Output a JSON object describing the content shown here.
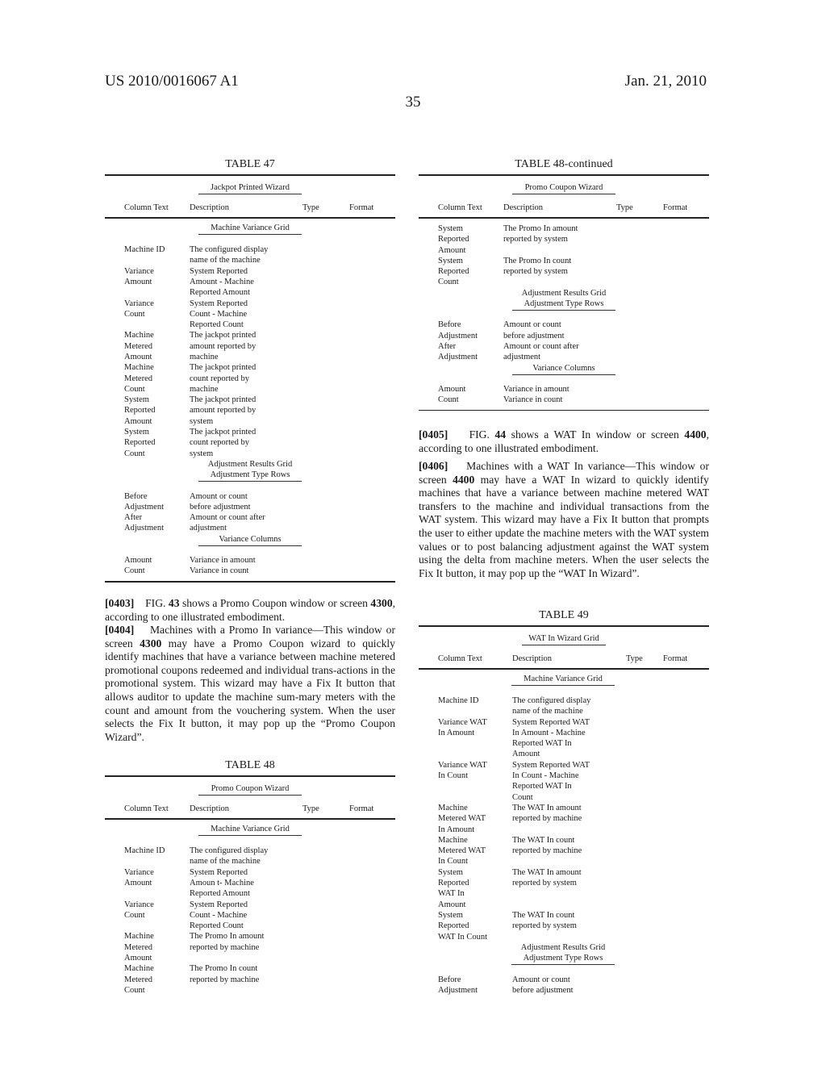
{
  "header": {
    "patent_number": "US 2010/0016067 A1",
    "date": "Jan. 21, 2010",
    "page_number": "35"
  },
  "column_headers": [
    "Column Text",
    "Description",
    "Type",
    "Format"
  ],
  "table47": {
    "title": "TABLE 47",
    "wizard": "Jackpot Printed Wizard",
    "sections": [
      {
        "heading": "Machine Variance Grid",
        "rows": [
          {
            "col": "Machine ID",
            "desc": "The configured display\nname of the machine"
          },
          {
            "col": "Variance\nAmount",
            "desc": "System Reported\nAmount - Machine\nReported Amount"
          },
          {
            "col": "Variance\nCount",
            "desc": "System Reported\nCount - Machine\nReported Count"
          },
          {
            "col": "Machine\nMetered\nAmount",
            "desc": "The jackpot printed\namount reported by\nmachine"
          },
          {
            "col": "Machine\nMetered\nCount",
            "desc": "The jackpot printed\ncount reported by\nmachine"
          },
          {
            "col": "System\nReported\nAmount",
            "desc": "The jackpot printed\namount reported by\nsystem"
          },
          {
            "col": "System\nReported\nCount",
            "desc": "The jackpot printed\ncount reported by\nsystem"
          }
        ]
      },
      {
        "heading_line1": "Adjustment Results Grid",
        "heading": "Adjustment Type Rows",
        "rows": [
          {
            "col": "Before\nAdjustment",
            "desc": "Amount or count\nbefore adjustment"
          },
          {
            "col": "After\nAdjustment",
            "desc": "Amount or count after\nadjustment"
          }
        ]
      },
      {
        "heading": "Variance Columns",
        "rows": [
          {
            "col": "Amount",
            "desc": "Variance in amount"
          },
          {
            "col": "Count",
            "desc": "Variance in count"
          }
        ]
      }
    ]
  },
  "paragraphs": {
    "p0403": {
      "num": "[0403]",
      "pre": "FIG. ",
      "fig": "43",
      "mid": " shows a Promo Coupon window or screen ",
      "ref": "4300",
      "post": ", according to one illustrated embodiment."
    },
    "p0404": {
      "num": "[0404]",
      "pre": "Machines with a Promo In variance—This window or screen ",
      "ref": "4300",
      "post": " may have a Promo Coupon wizard to quickly identify machines that have a variance between machine metered promotional coupons redeemed and individual trans-actions in the promotional system. This wizard may have a Fix It button that allows auditor to update the machine sum-mary meters with the count and amount from the vouchering system. When the user selects the Fix It button, it may pop up the “Promo Coupon Wizard”."
    },
    "p0405": {
      "num": "[0405]",
      "pre": "FIG. ",
      "fig": "44",
      "mid": " shows a WAT In window or screen ",
      "ref": "4400",
      "post": ", according to one illustrated embodiment."
    },
    "p0406": {
      "num": "[0406]",
      "pre": "Machines with a WAT In variance—This window or screen ",
      "ref": "4400",
      "post": " may have a WAT In wizard to quickly identify machines that have a variance between machine metered WAT transfers to the machine and individual transactions from the WAT system. This wizard may have a Fix It button that prompts the user to either update the machine meters with the WAT system values or to post balancing adjustment against the WAT system using the delta from machine meters. When the user selects the Fix It button, it may pop up the “WAT In Wizard”."
    }
  },
  "table48": {
    "title": "TABLE 48",
    "wizard": "Promo Coupon Wizard",
    "sections": [
      {
        "heading": "Machine Variance Grid",
        "rows": [
          {
            "col": "Machine ID",
            "desc": "The configured display\nname of the machine"
          },
          {
            "col": "Variance\nAmount",
            "desc": "System Reported\nAmoun t- Machine\nReported Amount"
          },
          {
            "col": "Variance\nCount",
            "desc": "System Reported\nCount - Machine\nReported Count"
          },
          {
            "col": "Machine\nMetered\nAmount",
            "desc": "The Promo In amount\nreported by machine"
          },
          {
            "col": "Machine\nMetered\nCount",
            "desc": "The Promo In count\nreported by machine"
          }
        ]
      }
    ]
  },
  "table48_cont": {
    "title": "TABLE 48-continued",
    "wizard": "Promo Coupon Wizard",
    "rows_top": [
      {
        "col": "System\nReported\nAmount",
        "desc": "The Promo In amount\nreported by system"
      },
      {
        "col": "System\nReported\nCount",
        "desc": "The Promo In count\nreported by system"
      }
    ],
    "sections": [
      {
        "heading_line1": "Adjustment Results Grid",
        "heading": "Adjustment Type Rows",
        "rows": [
          {
            "col": "Before\nAdjustment",
            "desc": "Amount or count\nbefore adjustment"
          },
          {
            "col": "After\nAdjustment",
            "desc": "Amount or count after\nadjustment"
          }
        ]
      },
      {
        "heading": "Variance Columns",
        "rows": [
          {
            "col": "Amount",
            "desc": "Variance in amount"
          },
          {
            "col": "Count",
            "desc": "Variance in count"
          }
        ]
      }
    ]
  },
  "table49": {
    "title": "TABLE 49",
    "wizard": "WAT In Wizard Grid",
    "sections": [
      {
        "heading": "Machine Variance Grid",
        "rows": [
          {
            "col": "Machine ID",
            "desc": "The configured display\nname of the machine"
          },
          {
            "col": "Variance WAT\nIn Amount",
            "desc": "System Reported WAT\nIn Amount - Machine\nReported WAT In\nAmount"
          },
          {
            "col": "Variance WAT\nIn Count",
            "desc": "System Reported WAT\nIn Count - Machine\nReported WAT In\nCount"
          },
          {
            "col": "Machine\nMetered WAT\nIn Amount",
            "desc": "The WAT In amount\nreported by machine"
          },
          {
            "col": "Machine\nMetered WAT\nIn Count",
            "desc": "The WAT In count\nreported by machine"
          },
          {
            "col": "System\nReported\nWAT In\nAmount",
            "desc": "The WAT In amount\nreported by system"
          },
          {
            "col": "System\nReported\nWAT In Count",
            "desc": "The WAT In count\nreported by system"
          }
        ]
      },
      {
        "heading_line1": "Adjustment Results Grid",
        "heading": "Adjustment Type Rows",
        "rows": [
          {
            "col": "Before\nAdjustment",
            "desc": "Amount or count\nbefore adjustment"
          }
        ]
      }
    ]
  }
}
